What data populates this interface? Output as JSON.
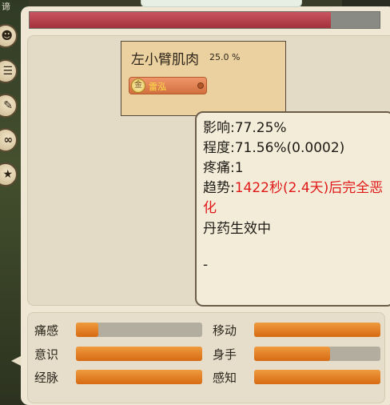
{
  "colors": {
    "hp_bar": "#a3323c",
    "stat_bar": "#d66a12",
    "warning_text": "#e01919",
    "tag_text": "#ffe24a"
  },
  "hp_bar": {
    "fill": 0.86
  },
  "side_menu": {
    "label": "谛",
    "icons": [
      "person-icon",
      "list-icon",
      "pencil-icon",
      "swirl-icon",
      "star-icon"
    ]
  },
  "body_part": {
    "name": "左小臂肌肉",
    "percent": "25.0 %",
    "tag": {
      "coin": "金",
      "label": "雷泓"
    }
  },
  "tooltip": {
    "influence": "影响:77.25%",
    "degree": "程度:71.56%(0.0002)",
    "pain": "疼痛:1",
    "trend_prefix": "趋势:",
    "trend_value": "1422秒(2.4天)后完全恶",
    "trend_value_cont": "化",
    "pill_status": "丹药生效中",
    "dash": "-"
  },
  "stats": [
    {
      "label": "痛感",
      "fill": 0.18
    },
    {
      "label": "移动",
      "fill": 1.0
    },
    {
      "label": "意识",
      "fill": 1.0
    },
    {
      "label": "身手",
      "fill": 0.6
    },
    {
      "label": "经脉",
      "fill": 1.0
    },
    {
      "label": "感知",
      "fill": 1.0
    }
  ]
}
